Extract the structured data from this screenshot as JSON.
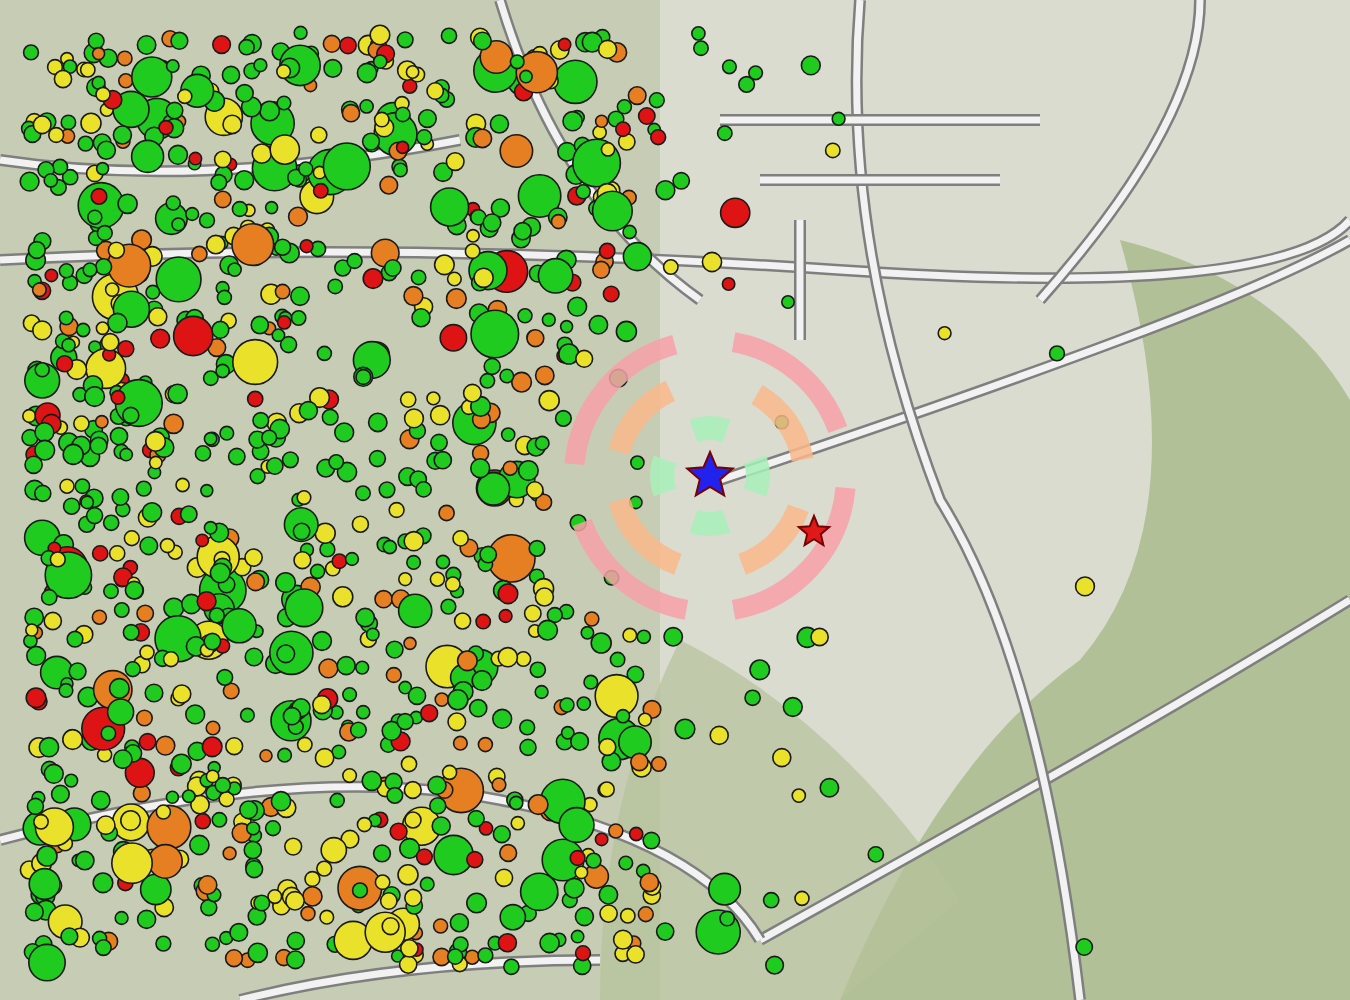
{
  "map": {
    "marker_classes": [
      {
        "color": "#1ecb1e"
      },
      {
        "color": "#eae22a"
      },
      {
        "color": "#e67e22"
      },
      {
        "color": "#de1414"
      }
    ]
  }
}
